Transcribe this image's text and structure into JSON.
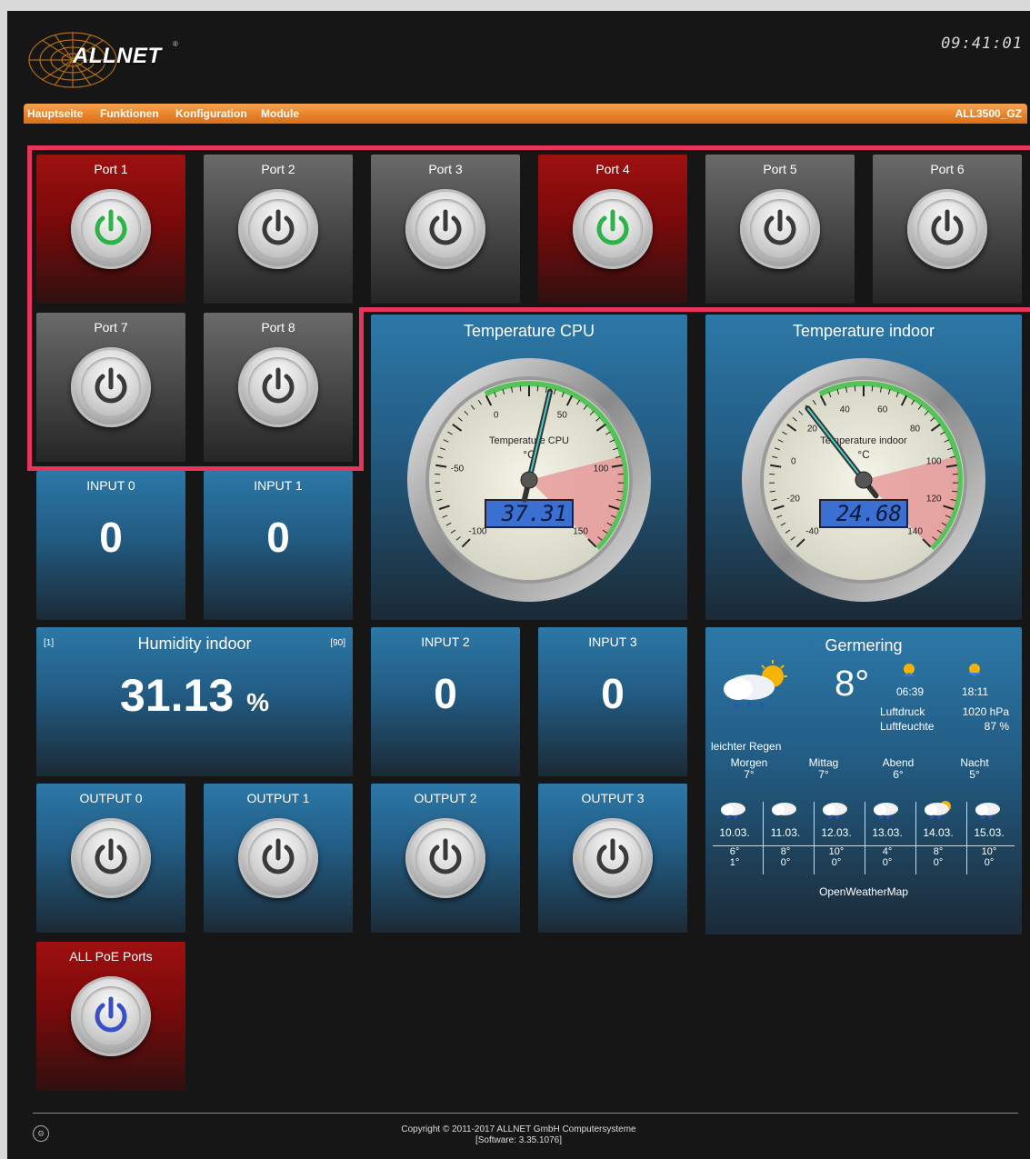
{
  "header": {
    "brand": "ALLNET",
    "brand_mark": "®",
    "clock": "09:41:01",
    "device_name": "ALL3500_GZ",
    "nav": [
      "Hauptseite",
      "Funktionen",
      "Konfiguration",
      "Module"
    ]
  },
  "ports": [
    {
      "label": "Port 1",
      "state": "on"
    },
    {
      "label": "Port 2",
      "state": "off"
    },
    {
      "label": "Port 3",
      "state": "off"
    },
    {
      "label": "Port 4",
      "state": "on"
    },
    {
      "label": "Port 5",
      "state": "off"
    },
    {
      "label": "Port 6",
      "state": "off"
    },
    {
      "label": "Port 7",
      "state": "off"
    },
    {
      "label": "Port 8",
      "state": "off"
    }
  ],
  "inputs": [
    {
      "label": "INPUT 0",
      "value": "0"
    },
    {
      "label": "INPUT 1",
      "value": "0"
    },
    {
      "label": "INPUT 2",
      "value": "0"
    },
    {
      "label": "INPUT 3",
      "value": "0"
    }
  ],
  "outputs": [
    {
      "label": "OUTPUT 0"
    },
    {
      "label": "OUTPUT 1"
    },
    {
      "label": "OUTPUT 2"
    },
    {
      "label": "OUTPUT 3"
    }
  ],
  "poe": {
    "label": "ALL PoE Ports"
  },
  "gauge_cpu": {
    "title": "Temperature CPU",
    "face_label": "Temperature CPU",
    "unit": "°C",
    "value": 37.31,
    "display": "37.31",
    "min": -100,
    "max": 150,
    "ticks": [
      "-100",
      "-50",
      "0",
      "50",
      "100",
      "150"
    ]
  },
  "gauge_indoor": {
    "title": "Temperature indoor",
    "face_label": "Temperature indoor",
    "unit": "°C",
    "value": 24.68,
    "display": "24.68",
    "min": -40,
    "max": 140,
    "ticks": [
      "-40",
      "-20",
      "0",
      "20",
      "40",
      "60",
      "80",
      "100",
      "120",
      "140"
    ]
  },
  "humidity": {
    "title": "Humidity indoor",
    "min_label": "[1]",
    "max_label": "[90]",
    "value": "31.13",
    "unit": "%"
  },
  "weather": {
    "city": "Germering",
    "temp": "8°",
    "sunrise": "06:39",
    "sunset": "18:11",
    "pressure_label": "Luftdruck",
    "pressure": "1020 hPa",
    "humidity_label": "Luftfeuchte",
    "humidity": "87 %",
    "condition": "leichter Regen",
    "dayparts": [
      {
        "name": "Morgen",
        "temp": "7°"
      },
      {
        "name": "Mittag",
        "temp": "7°"
      },
      {
        "name": "Abend",
        "temp": "6°"
      },
      {
        "name": "Nacht",
        "temp": "5°"
      }
    ],
    "forecast": [
      {
        "date": "10.03.",
        "max": "6°",
        "min": "1°"
      },
      {
        "date": "11.03.",
        "max": "8°",
        "min": "0°"
      },
      {
        "date": "12.03.",
        "max": "10°",
        "min": "0°"
      },
      {
        "date": "13.03.",
        "max": "4°",
        "min": "0°"
      },
      {
        "date": "14.03.",
        "max": "8°",
        "min": "0°"
      },
      {
        "date": "15.03.",
        "max": "10°",
        "min": "0°"
      }
    ],
    "provider": "OpenWeatherMap"
  },
  "footer": {
    "copyright": "Copyright © 2011-2017 ALLNET GmbH Computersysteme",
    "software": "[Software: 3.35.1076]"
  },
  "colors": {
    "accent": "#e8832a",
    "highlight": "#e8345a",
    "on_green": "#2db34a",
    "poe_blue": "#3a4fc4",
    "tile_red": "#7a0a0a",
    "tile_blue": "#225b82"
  }
}
